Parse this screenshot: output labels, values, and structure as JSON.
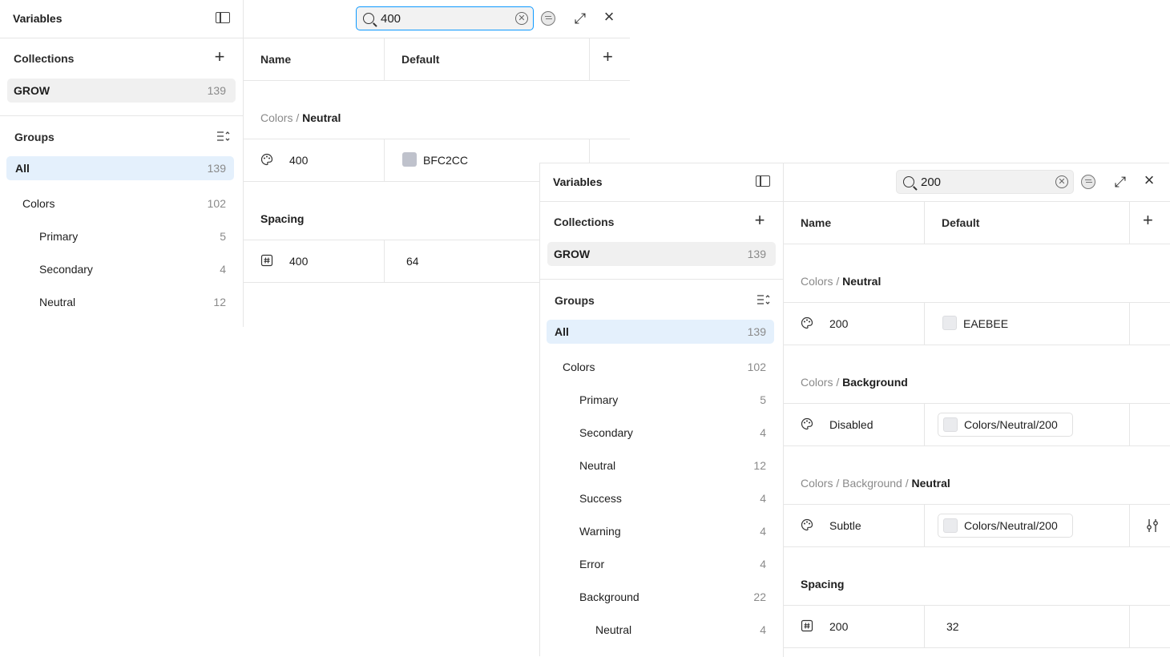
{
  "panel_a": {
    "sidebar": {
      "title": "Variables",
      "collections_label": "Collections",
      "collection": {
        "name": "GROW",
        "count": "139"
      },
      "groups_label": "Groups",
      "groups": [
        {
          "label": "All",
          "count": "139"
        },
        {
          "label": "Colors",
          "count": "102"
        },
        {
          "label": "Primary",
          "count": "5"
        },
        {
          "label": "Secondary",
          "count": "4"
        },
        {
          "label": "Neutral",
          "count": "12"
        }
      ]
    },
    "search": {
      "value": "400"
    },
    "table": {
      "col_name": "Name",
      "col_default": "Default",
      "groups": [
        {
          "path": "Colors / ",
          "leaf": "Neutral",
          "row": {
            "name": "400",
            "value": "BFC2CC",
            "swatch": "#bfc2cc"
          }
        },
        {
          "path": "",
          "leaf": "Spacing",
          "row": {
            "name": "400",
            "value": "64"
          }
        }
      ]
    }
  },
  "panel_b": {
    "sidebar": {
      "title": "Variables",
      "collections_label": "Collections",
      "collection": {
        "name": "GROW",
        "count": "139"
      },
      "groups_label": "Groups",
      "groups": [
        {
          "label": "All",
          "count": "139"
        },
        {
          "label": "Colors",
          "count": "102"
        },
        {
          "label": "Primary",
          "count": "5"
        },
        {
          "label": "Secondary",
          "count": "4"
        },
        {
          "label": "Neutral",
          "count": "12"
        },
        {
          "label": "Success",
          "count": "4"
        },
        {
          "label": "Warning",
          "count": "4"
        },
        {
          "label": "Error",
          "count": "4"
        },
        {
          "label": "Background",
          "count": "22"
        },
        {
          "label": "Neutral",
          "count": "4"
        }
      ]
    },
    "search": {
      "value": "200"
    },
    "table": {
      "col_name": "Name",
      "col_default": "Default",
      "groups": [
        {
          "path": "Colors / ",
          "leaf": "Neutral",
          "row": {
            "name": "200",
            "value": "EAEBEE",
            "swatch": "#eaebee"
          }
        },
        {
          "path": "Colors / ",
          "leaf": "Background",
          "row": {
            "name": "Disabled",
            "alias": "Colors/Neutral/200",
            "swatch": "#eaebee"
          }
        },
        {
          "path": "Colors / Background / ",
          "leaf": "Neutral",
          "row": {
            "name": "Subtle",
            "alias": "Colors/Neutral/200",
            "swatch": "#eaebee"
          }
        },
        {
          "path": "",
          "leaf": "Spacing",
          "row": {
            "name": "200",
            "value": "32"
          }
        }
      ]
    }
  },
  "icons": {
    "color_variable": "palette-icon",
    "number_variable": "hash-box-icon"
  },
  "colors": {
    "selected_bg": "#e4f0fc",
    "focus": "#0d99ff"
  }
}
